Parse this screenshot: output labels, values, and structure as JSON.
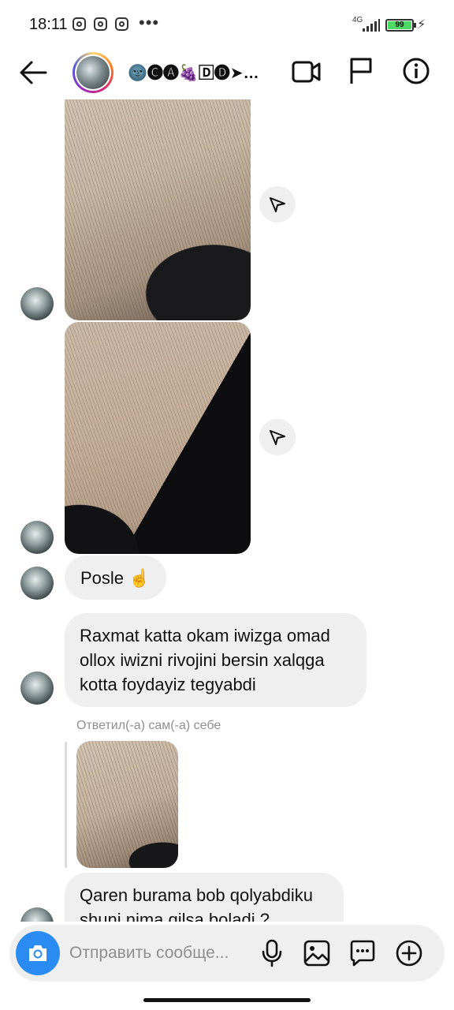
{
  "status_bar": {
    "time": "18:11",
    "dots": "•••",
    "network": "4G",
    "battery": "99"
  },
  "header": {
    "name": "🌚🅒🅐🍇🄳🅓➤P̳A̳D̳I̳...",
    "icons": [
      "back-arrow-icon",
      "video-call-icon",
      "flag-icon",
      "info-icon"
    ]
  },
  "messages": [
    {
      "type": "image",
      "description_icon": "photo"
    },
    {
      "type": "image",
      "description_icon": "photo"
    },
    {
      "type": "text",
      "text": "Posle ☝️"
    },
    {
      "type": "text",
      "text": "Raxmat katta okam iwizga omad ollox iwizni rivojini bersin xalqga kotta foydayiz tegyabdi"
    },
    {
      "type": "reply",
      "label": "Ответил(-а) сам(-а) себе"
    },
    {
      "type": "text",
      "text": "Qaren burama bob qolyabdiku shuni nima qilsa boladi ?"
    }
  ],
  "composer": {
    "placeholder": "Отправить сообще..."
  },
  "colors": {
    "accent": "#2a8cf3",
    "bubble": "#efefef",
    "battery": "#4cd964",
    "muted": "#8e8e8e"
  }
}
